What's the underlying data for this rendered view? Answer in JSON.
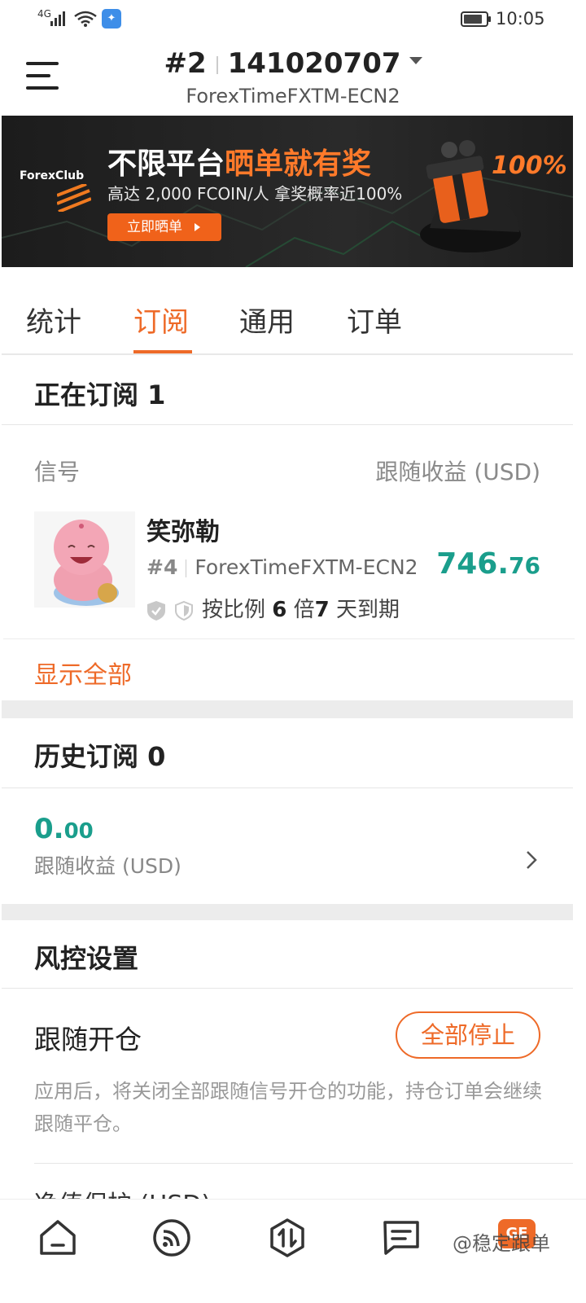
{
  "status_bar": {
    "network": "4G",
    "time": "10:05"
  },
  "header": {
    "account_index": "#2",
    "account_number": "141020707",
    "server": "ForexTimeFXTM-ECN2"
  },
  "banner": {
    "brand": "ForexClub",
    "title_white": "不限平台",
    "title_orange": "晒单就有奖",
    "subtitle": "高达 2,000 FCOIN/人  拿奖概率近100%",
    "button": "立即晒单",
    "badge": "100%"
  },
  "tabs": [
    {
      "label": "统计"
    },
    {
      "label": "订阅"
    },
    {
      "label": "通用"
    },
    {
      "label": "订单"
    }
  ],
  "active_tab": "订阅",
  "current_subscriptions": {
    "heading": "正在订阅 1",
    "col_signal": "信号",
    "col_profit": "跟随收益 (USD)",
    "item": {
      "name": "笑弥勒",
      "rank": "#4",
      "server": "ForexTimeFXTM-ECN2",
      "profit_int": "746.",
      "profit_dec": "76",
      "mode_prefix": "按比例",
      "ratio": "6",
      "ratio_unit": "倍",
      "days": "7",
      "days_suffix": "天到期"
    },
    "show_all": "显示全部"
  },
  "history": {
    "heading": "历史订阅 0",
    "amount_int": "0.",
    "amount_dec": "00",
    "label": "跟随收益 (USD)"
  },
  "risk": {
    "heading": "风控设置",
    "follow_open_title": "跟随开仓",
    "stop_all_button": "全部停止",
    "description": "应用后，将关闭全部跟随信号开仓的功能，持仓订单会继续跟随平仓。",
    "next_item_partial": "净值保护 (USD)"
  },
  "bottom_nav": {
    "items": [
      {
        "icon": "home-icon"
      },
      {
        "icon": "signal-icon"
      },
      {
        "icon": "trade-icon"
      },
      {
        "icon": "message-icon"
      },
      {
        "icon": "badge-icon"
      }
    ],
    "badge_text": "GE",
    "watermark": "@稳定跟单"
  }
}
